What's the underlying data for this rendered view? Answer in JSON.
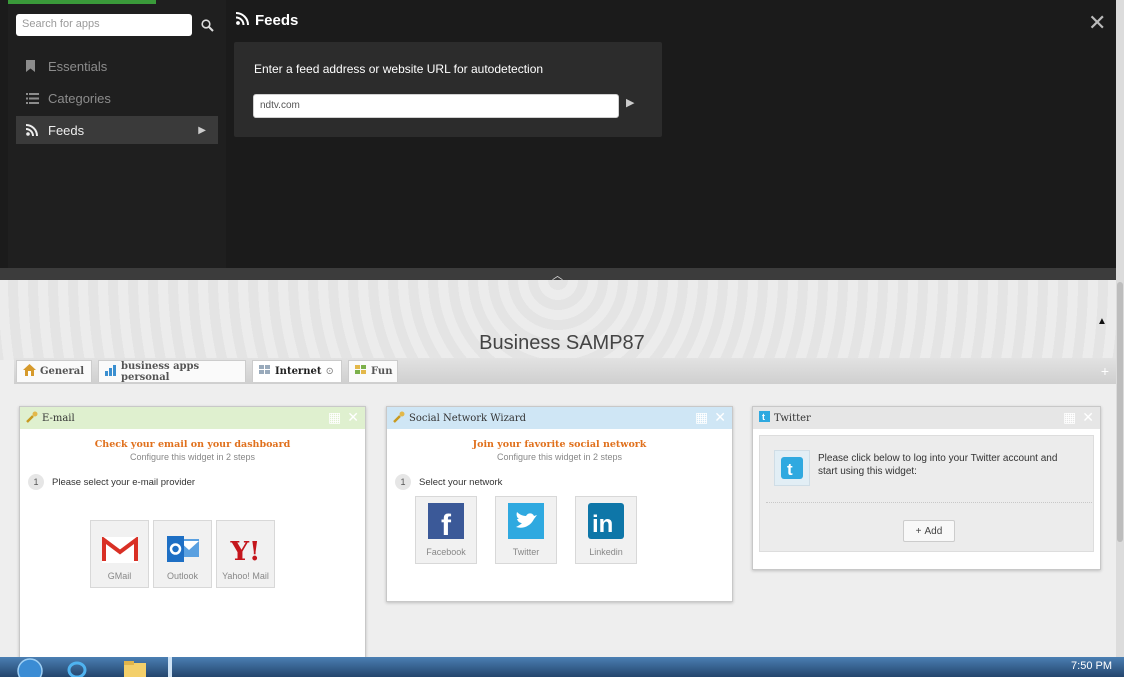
{
  "sidebar": {
    "search_placeholder": "Search for apps",
    "items": [
      {
        "label": "Essentials",
        "icon": "bookmark-icon"
      },
      {
        "label": "Categories",
        "icon": "list-icon"
      },
      {
        "label": "Feeds",
        "icon": "rss-icon"
      }
    ],
    "active_item": "Feeds"
  },
  "feeds_panel": {
    "title": "Feeds",
    "prompt": "Enter a feed address or website URL for autodetection",
    "url_value": "ndtv.com"
  },
  "dashboard": {
    "title": "Business SAMP87",
    "tabs": [
      {
        "label": "General"
      },
      {
        "label": "business apps personal"
      },
      {
        "label": "Internet"
      },
      {
        "label": "Fun"
      }
    ],
    "active_tab": "Internet"
  },
  "widgets": {
    "email": {
      "title": "E-mail",
      "headline": "Check your email on your dashboard",
      "subline": "Configure this widget in 2 steps",
      "step_number": "1",
      "step_label": "Please select your e-mail provider",
      "providers": [
        "GMail",
        "Outlook",
        "Yahoo! Mail"
      ]
    },
    "social": {
      "title": "Social Network Wizard",
      "headline": "Join your favorite social network",
      "subline": "Configure this widget in 2 steps",
      "step_number": "1",
      "step_label": "Select your network",
      "networks": [
        "Facebook",
        "Twitter",
        "Linkedin"
      ]
    },
    "twitter": {
      "title": "Twitter",
      "message": "Please click below to log into your Twitter account and start using this widget:",
      "add_label": "Add"
    }
  },
  "taskbar": {
    "clock": "7:50 PM"
  },
  "colors": {
    "email_header": "#dff0cf",
    "social_header": "#cfe6f5",
    "twitter_header": "#e6e6e6",
    "headline": "#e0701c",
    "facebook": "#3b5998",
    "twitter": "#2fa9e0",
    "linkedin": "#0e76a8"
  }
}
